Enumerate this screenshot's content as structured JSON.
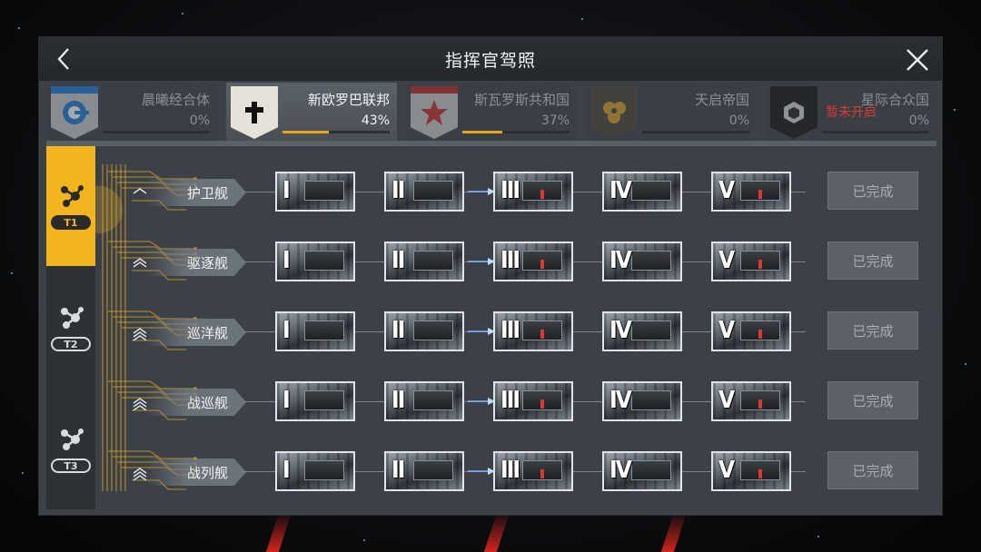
{
  "header": {
    "title": "指挥官驾照"
  },
  "factions": [
    {
      "name": "晨曦经合体",
      "percent": "0%",
      "progress": 0.0,
      "active": false,
      "emblem": "ring-emblem-icon",
      "accent": "#1e7fd8",
      "locked_text": ""
    },
    {
      "name": "新欧罗巴联邦",
      "percent": "43%",
      "progress": 0.43,
      "active": true,
      "emblem": "cross-emblem-icon",
      "accent": "#ffffff",
      "locked_text": ""
    },
    {
      "name": "斯瓦罗斯共和国",
      "percent": "37%",
      "progress": 0.37,
      "active": false,
      "emblem": "star-emblem-icon",
      "accent": "#c7302a",
      "locked_text": ""
    },
    {
      "name": "天启帝国",
      "percent": "0%",
      "progress": 0.0,
      "active": false,
      "emblem": "cluster-emblem-icon",
      "accent": "#d7a224",
      "locked_text": ""
    },
    {
      "name": "星际合众国",
      "percent": "0%",
      "progress": 0.0,
      "active": false,
      "emblem": "cube-emblem-icon",
      "accent": "#000000",
      "locked_text": "暂未开启"
    }
  ],
  "tiers": [
    {
      "label": "T1",
      "active": true
    },
    {
      "label": "T2",
      "active": false
    },
    {
      "label": "T3",
      "active": false
    }
  ],
  "ship_rows": [
    {
      "label": "护卫舰",
      "status": "已完成",
      "stages": [
        "I",
        "II",
        "III",
        "IV",
        "V"
      ],
      "rank_icon": "chevron-rank-1-icon"
    },
    {
      "label": "驱逐舰",
      "status": "已完成",
      "stages": [
        "I",
        "II",
        "III",
        "IV",
        "V"
      ],
      "rank_icon": "chevron-rank-2-icon"
    },
    {
      "label": "巡洋舰",
      "status": "已完成",
      "stages": [
        "I",
        "II",
        "III",
        "IV",
        "V"
      ],
      "rank_icon": "chevron-rank-3-icon"
    },
    {
      "label": "战巡舰",
      "status": "已完成",
      "stages": [
        "I",
        "II",
        "III",
        "IV",
        "V"
      ],
      "rank_icon": "chevron-rank-4-icon"
    },
    {
      "label": "战列舰",
      "status": "已完成",
      "stages": [
        "I",
        "II",
        "III",
        "IV",
        "V"
      ],
      "rank_icon": "chevron-rank-5-icon"
    }
  ],
  "colors": {
    "accent_gold": "#f3b51e",
    "progress_gold": "#e7a51f",
    "locked_red": "#d83a32"
  }
}
